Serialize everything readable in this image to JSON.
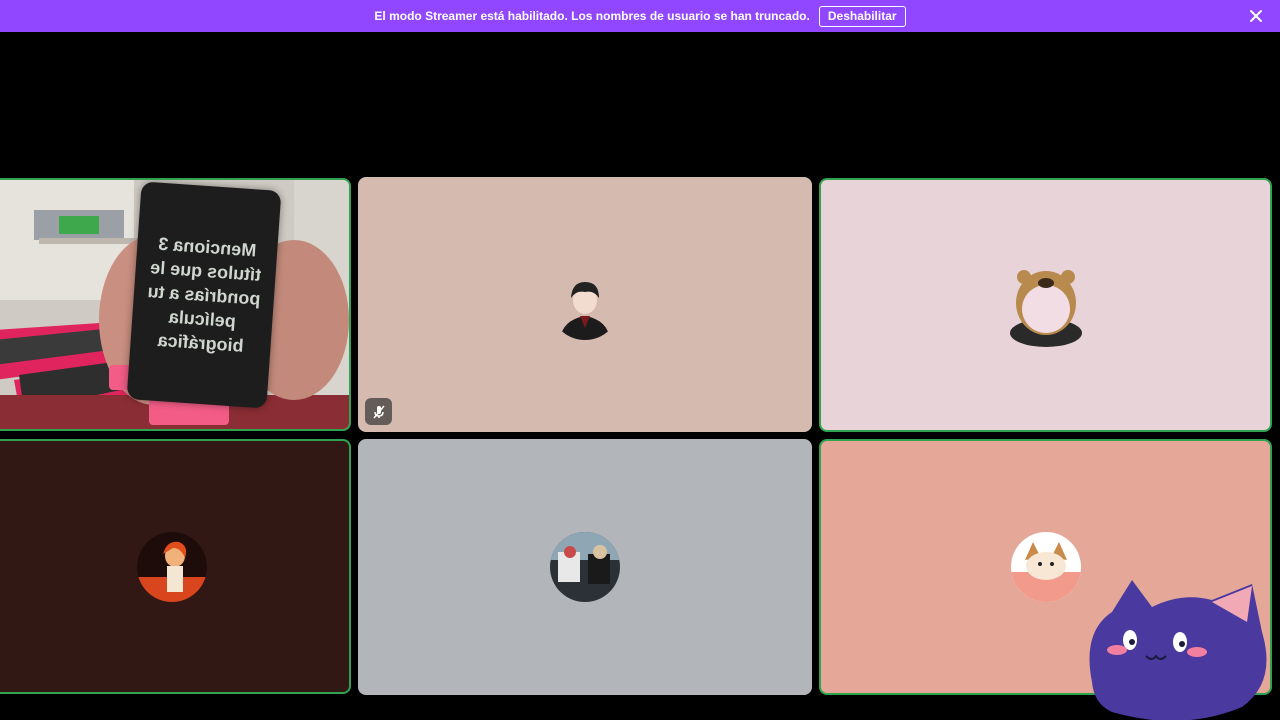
{
  "banner": {
    "message": "El modo Streamer está habilitado. Los nombres de usuario se han truncado.",
    "button_label": "Deshabilitar",
    "background": "#9146ff"
  },
  "tiles": [
    {
      "id": "camera",
      "type": "video",
      "speaking": true,
      "card_text": "Menciona 3 títulos que le pondrías a tu película biográfica"
    },
    {
      "id": "participant-2",
      "type": "avatar",
      "speaking": false,
      "muted": true,
      "background": "#d5bab0"
    },
    {
      "id": "participant-3",
      "type": "avatar",
      "speaking": true,
      "muted": false,
      "background": "#e8d3d9"
    },
    {
      "id": "participant-4",
      "type": "avatar",
      "speaking": true,
      "muted": false,
      "background": "#321815"
    },
    {
      "id": "participant-5",
      "type": "avatar",
      "speaking": false,
      "muted": false,
      "background": "#b2b6ba"
    },
    {
      "id": "participant-6",
      "type": "avatar",
      "speaking": true,
      "muted": false,
      "background": "#e5a798"
    }
  ],
  "icons": {
    "close": "close-icon",
    "mute": "mic-muted-icon"
  },
  "colors": {
    "speaking_border": "#2fa34f",
    "stage": "#000000"
  }
}
